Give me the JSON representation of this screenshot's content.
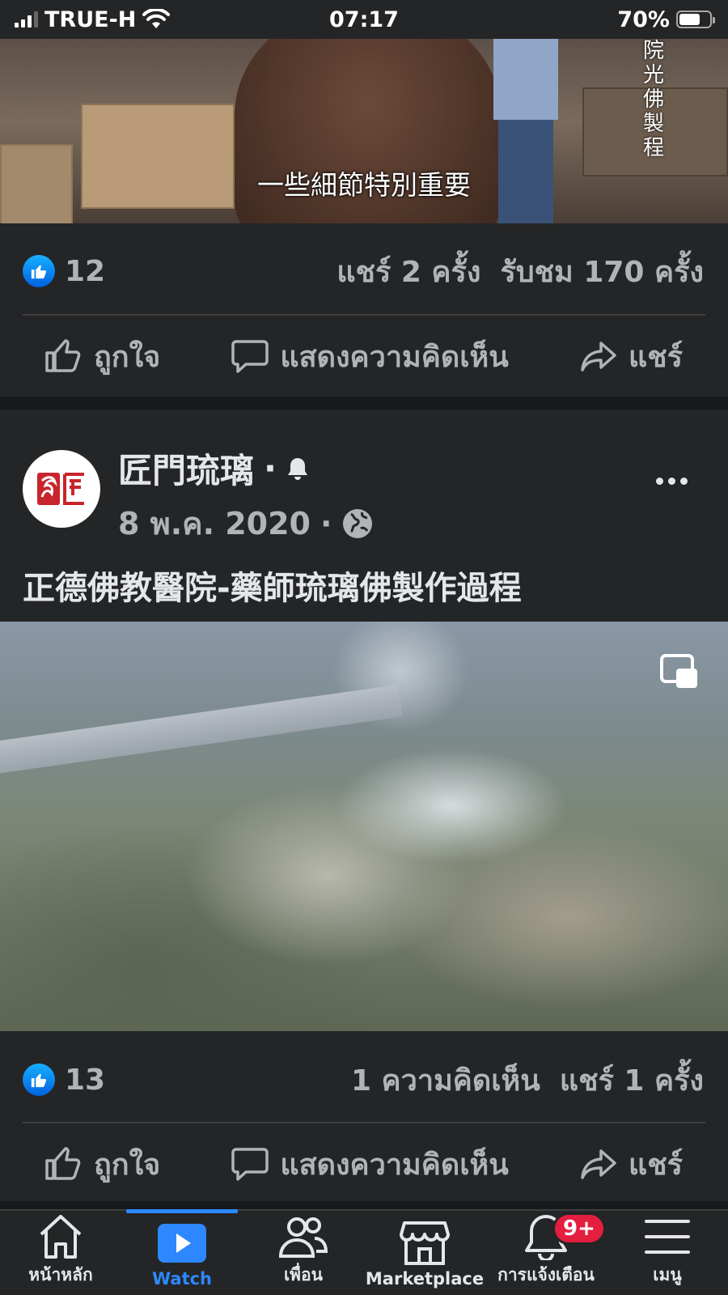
{
  "status_bar": {
    "carrier": "TRUE-H",
    "time": "07:17",
    "battery": "70%",
    "battery_level": 0.7
  },
  "prev_post": {
    "video": {
      "subtitle": "一些細節特別重要",
      "vertical_caption": "院光佛製程"
    },
    "likes": "12",
    "shares": "แชร์ 2 ครั้ง",
    "views": "รับชม 170 ครั้ง",
    "actions": {
      "like": "ถูกใจ",
      "comment": "แสดงความคิดเห็น",
      "share": "แชร์"
    }
  },
  "post": {
    "page_name": "匠門琉璃",
    "date": "8 พ.ค. 2020",
    "text": "正德佛教醫院-藥師琉璃佛製作過程",
    "likes": "13",
    "comments": "1 ความคิดเห็น",
    "shares": "แชร์ 1 ครั้ง",
    "actions": {
      "like": "ถูกใจ",
      "comment": "แสดงความคิดเห็น",
      "share": "แชร์"
    }
  },
  "bottom_nav": {
    "items": [
      {
        "label": "หน้าหลัก",
        "icon": "home-icon"
      },
      {
        "label": "Watch",
        "icon": "watch-icon"
      },
      {
        "label": "เพื่อน",
        "icon": "friends-icon"
      },
      {
        "label": "Marketplace",
        "icon": "marketplace-icon"
      },
      {
        "label": "การแจ้งเตือน",
        "icon": "bell-icon"
      },
      {
        "label": "เมนู",
        "icon": "menu-icon"
      }
    ],
    "active": "Watch",
    "notification_badge": "9+"
  },
  "colors": {
    "background": "#18191a",
    "card": "#242526",
    "accent": "#2d88ff",
    "badge": "#e41e3f"
  }
}
